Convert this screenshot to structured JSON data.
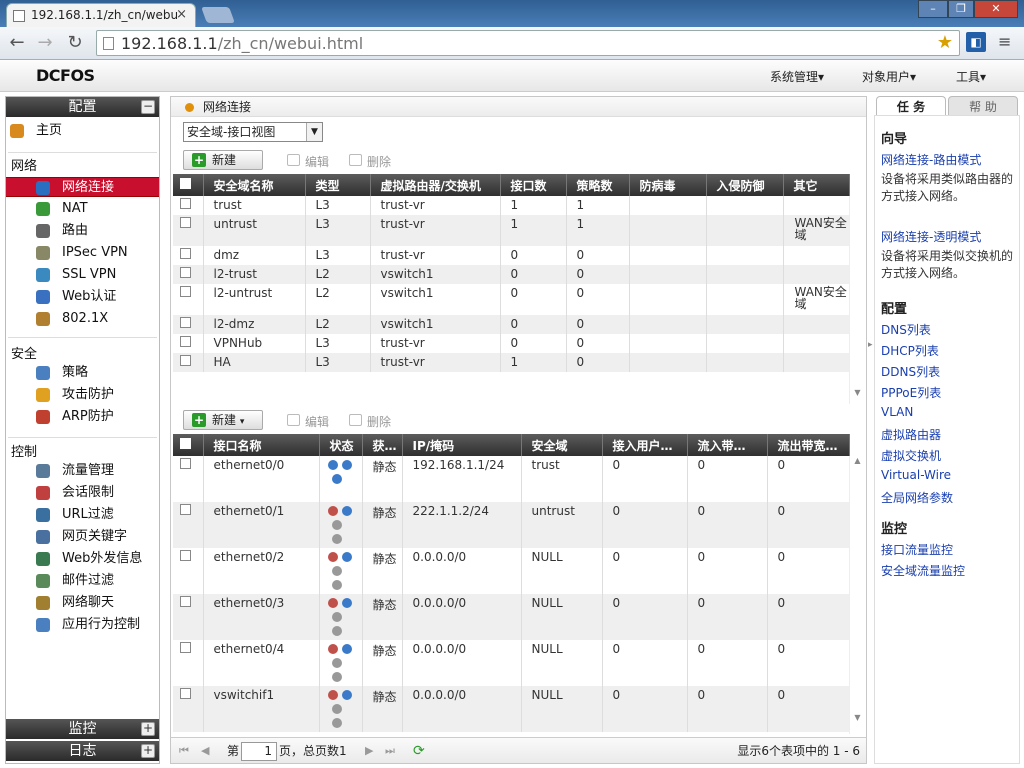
{
  "browser": {
    "tab_title": "192.168.1.1/zh_cn/webu",
    "url_host": "192.168.1.1",
    "url_path": "/zh_cn/webui.html"
  },
  "app": {
    "logo": "DCFOS",
    "menus": [
      "系统管理▾",
      "对象用户▾",
      "工具▾"
    ]
  },
  "sidebar": {
    "config_title": "配置",
    "home": "主页",
    "groups": [
      {
        "title": "网络",
        "items": [
          "网络连接",
          "NAT",
          "路由",
          "IPSec VPN",
          "SSL VPN",
          "Web认证",
          "802.1X"
        ]
      },
      {
        "title": "安全",
        "items": [
          "策略",
          "攻击防护",
          "ARP防护"
        ]
      },
      {
        "title": "控制",
        "items": [
          "流量管理",
          "会话限制",
          "URL过滤",
          "网页关键字",
          "Web外发信息",
          "邮件过滤",
          "网络聊天",
          "应用行为控制"
        ]
      }
    ],
    "selected": "网络连接",
    "monitor_title": "监控",
    "log_title": "日志"
  },
  "main": {
    "breadcrumb": "网络连接",
    "view_select": "安全域-接口视图",
    "new_label": "新建",
    "edit_label": "编辑",
    "delete_label": "删除",
    "zone_table": {
      "headers": [
        "安全域名称",
        "类型",
        "虚拟路由器/交换机",
        "接口数",
        "策略数",
        "防病毒",
        "入侵防御",
        "其它"
      ],
      "rows": [
        [
          "trust",
          "L3",
          "trust-vr",
          "1",
          "1",
          "",
          "",
          ""
        ],
        [
          "untrust",
          "L3",
          "trust-vr",
          "1",
          "1",
          "",
          "",
          "WAN安全域"
        ],
        [
          "dmz",
          "L3",
          "trust-vr",
          "0",
          "0",
          "",
          "",
          ""
        ],
        [
          "l2-trust",
          "L2",
          "vswitch1",
          "0",
          "0",
          "",
          "",
          ""
        ],
        [
          "l2-untrust",
          "L2",
          "vswitch1",
          "0",
          "0",
          "",
          "",
          "WAN安全域"
        ],
        [
          "l2-dmz",
          "L2",
          "vswitch1",
          "0",
          "0",
          "",
          "",
          ""
        ],
        [
          "VPNHub",
          "L3",
          "trust-vr",
          "0",
          "0",
          "",
          "",
          ""
        ],
        [
          "HA",
          "L3",
          "trust-vr",
          "1",
          "0",
          "",
          "",
          ""
        ]
      ]
    },
    "iface_table": {
      "headers": [
        "接口名称",
        "状态",
        "获…",
        "IP/掩码",
        "安全域",
        "接入用户…",
        "流入带…",
        "流出带宽…"
      ],
      "rows": [
        [
          "ethernet0/0",
          "up",
          "静态",
          "192.168.1.1/24",
          "trust",
          "0",
          "0",
          "0"
        ],
        [
          "ethernet0/1",
          "down",
          "静态",
          "222.1.1.2/24",
          "untrust",
          "0",
          "0",
          "0"
        ],
        [
          "ethernet0/2",
          "down",
          "静态",
          "0.0.0.0/0",
          "NULL",
          "0",
          "0",
          "0"
        ],
        [
          "ethernet0/3",
          "down",
          "静态",
          "0.0.0.0/0",
          "NULL",
          "0",
          "0",
          "0"
        ],
        [
          "ethernet0/4",
          "down",
          "静态",
          "0.0.0.0/0",
          "NULL",
          "0",
          "0",
          "0"
        ],
        [
          "vswitchif1",
          "down",
          "静态",
          "0.0.0.0/0",
          "NULL",
          "0",
          "0",
          "0"
        ]
      ]
    },
    "pager": {
      "page_prefix": "第",
      "page_value": "1",
      "page_suffix": "页，总页数1",
      "summary": "显示6个表项中的 1 - 6"
    }
  },
  "right": {
    "tab_tasks": "任 务",
    "tab_help": "帮 助",
    "wizard_title": "向导",
    "wizard_items": [
      {
        "link": "网络连接-路由模式",
        "desc": "设备将采用类似路由器的方式接入网络。"
      },
      {
        "link": "网络连接-透明模式",
        "desc": "设备将采用类似交换机的方式接入网络。"
      }
    ],
    "config_title": "配置",
    "config_links": [
      "DNS列表",
      "DHCP列表",
      "DDNS列表",
      "PPPoE列表",
      "VLAN",
      "虚拟路由器",
      "虚拟交换机",
      "Virtual-Wire",
      "全局网络参数"
    ],
    "monitor_title": "监控",
    "monitor_links": [
      "接口流量监控",
      "安全域流量监控"
    ]
  },
  "colors": {
    "selected": "#c8102e",
    "link": "#1a3fae",
    "header": "#3a3a3a"
  }
}
